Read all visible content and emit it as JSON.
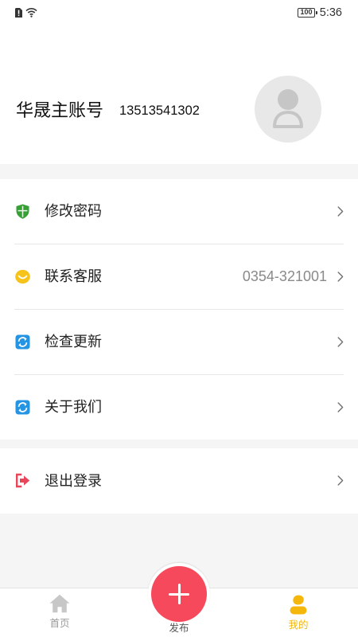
{
  "status_bar": {
    "battery": "100",
    "time": "5:36",
    "icons": [
      "sim-alert-icon",
      "wifi-icon",
      "battery-icon"
    ]
  },
  "profile": {
    "account_name": "华晟主账号",
    "phone": "13513541302",
    "avatar_icon": "default-avatar-icon"
  },
  "menu": {
    "chevron_icon": "chevron-right-icon",
    "items": [
      {
        "label": "修改密码",
        "icon": "shield-icon"
      },
      {
        "label": "联系客服",
        "icon": "smile-icon",
        "value": "0354-321001"
      },
      {
        "label": "检查更新",
        "icon": "refresh-icon"
      },
      {
        "label": "关于我们",
        "icon": "refresh-icon"
      }
    ]
  },
  "logout": {
    "label": "退出登录",
    "icon": "logout-icon"
  },
  "tab_bar": {
    "tabs": [
      {
        "label": "首页",
        "icon": "home-icon",
        "active": false
      },
      {
        "label": "发布",
        "icon": "plus-icon",
        "active": false
      },
      {
        "label": "我的",
        "icon": "user-icon",
        "active": true
      }
    ]
  },
  "colors": {
    "background": "#f5f5f5",
    "surface": "#ffffff",
    "shield": "#37a035",
    "smile": "#f6c21c",
    "refresh": "#2594e3",
    "logout": "#e9465b",
    "publish_button": "#f64a5c",
    "active_tab": "#f5b70c",
    "inactive_tab": "#c7c7c7"
  }
}
